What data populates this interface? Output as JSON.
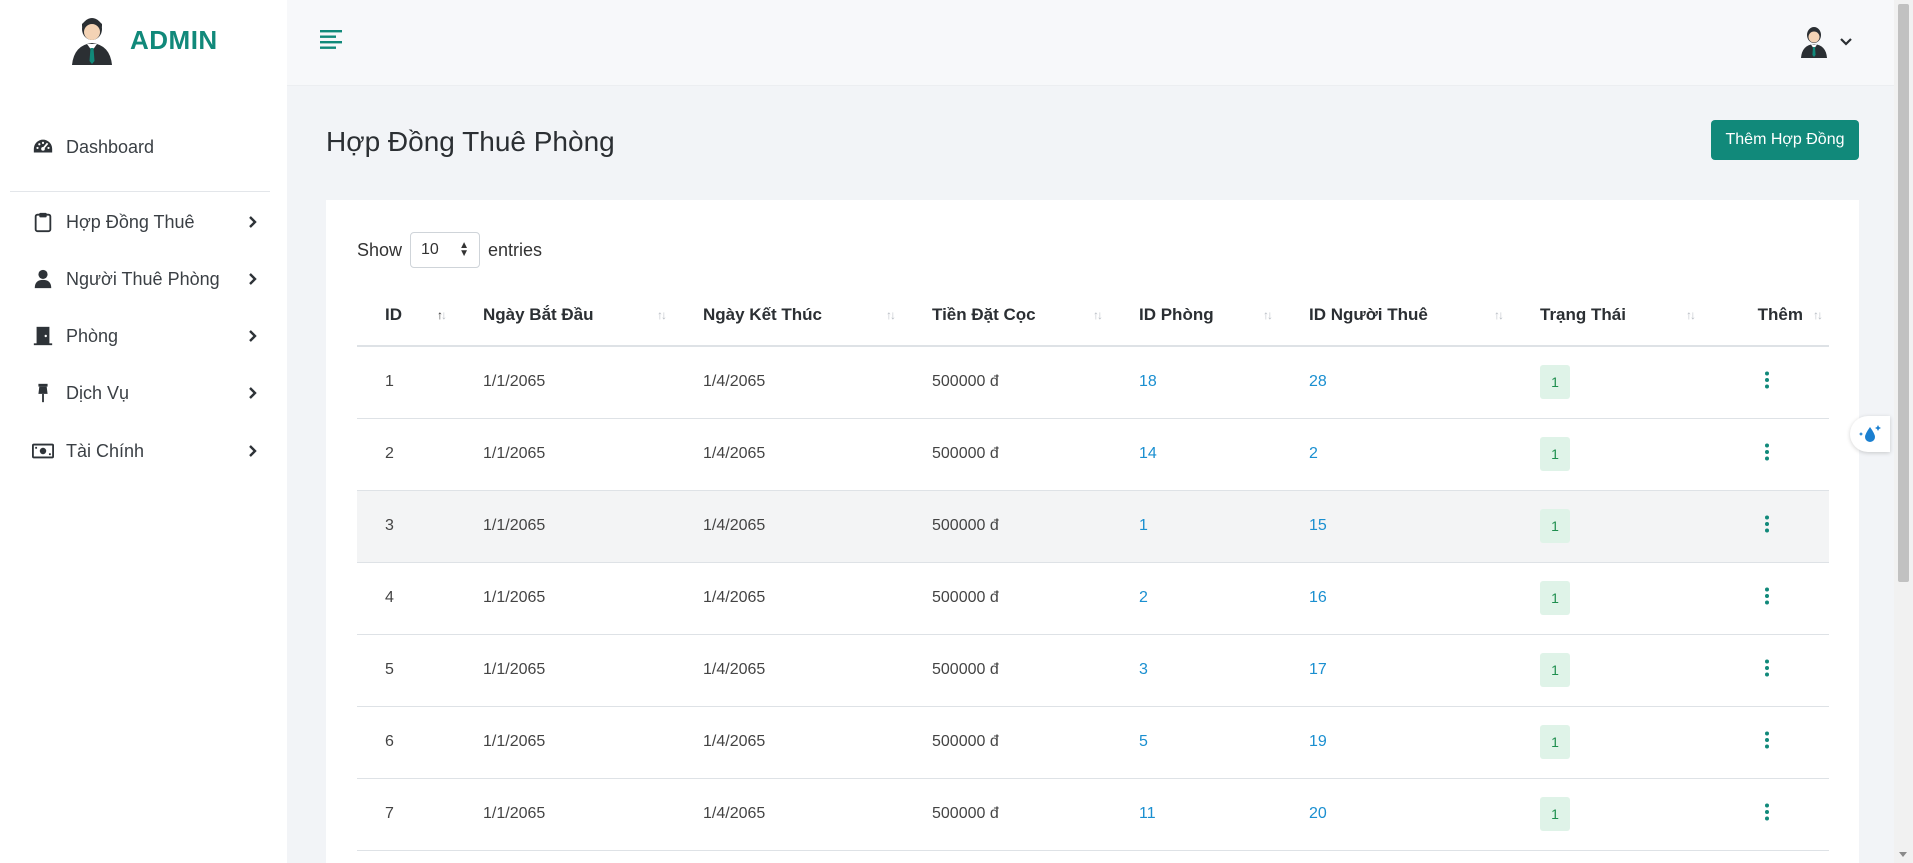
{
  "brand": {
    "title": "ADMIN"
  },
  "sidebar": {
    "dashboard": "Dashboard",
    "items": [
      {
        "label": "Hợp Đồng Thuê",
        "icon": "clipboard-icon"
      },
      {
        "label": "Người Thuê Phòng",
        "icon": "user-icon"
      },
      {
        "label": "Phòng",
        "icon": "door-icon"
      },
      {
        "label": "Dịch Vụ",
        "icon": "pin-icon"
      },
      {
        "label": "Tài Chính",
        "icon": "money-icon"
      }
    ]
  },
  "page": {
    "title": "Hợp Đồng Thuê Phòng",
    "add_button": "Thêm Hợp Đồng"
  },
  "table_controls": {
    "show": "Show",
    "entries_value": "10",
    "entries": "entries"
  },
  "table": {
    "columns": [
      "ID",
      "Ngày Bắt Đầu",
      "Ngày Kết Thúc",
      "Tiền Đặt Cọc",
      "ID Phòng",
      "ID Người Thuê",
      "Trạng Thái",
      "Thêm"
    ],
    "sorted_column": "ID",
    "rows": [
      {
        "id": "1",
        "start": "1/1/2065",
        "end": "1/4/2065",
        "deposit": "500000 đ",
        "room": "18",
        "tenant": "28",
        "status": "1"
      },
      {
        "id": "2",
        "start": "1/1/2065",
        "end": "1/4/2065",
        "deposit": "500000 đ",
        "room": "14",
        "tenant": "2",
        "status": "1"
      },
      {
        "id": "3",
        "start": "1/1/2065",
        "end": "1/4/2065",
        "deposit": "500000 đ",
        "room": "1",
        "tenant": "15",
        "status": "1"
      },
      {
        "id": "4",
        "start": "1/1/2065",
        "end": "1/4/2065",
        "deposit": "500000 đ",
        "room": "2",
        "tenant": "16",
        "status": "1"
      },
      {
        "id": "5",
        "start": "1/1/2065",
        "end": "1/4/2065",
        "deposit": "500000 đ",
        "room": "3",
        "tenant": "17",
        "status": "1"
      },
      {
        "id": "6",
        "start": "1/1/2065",
        "end": "1/4/2065",
        "deposit": "500000 đ",
        "room": "5",
        "tenant": "19",
        "status": "1"
      },
      {
        "id": "7",
        "start": "1/1/2065",
        "end": "1/4/2065",
        "deposit": "500000 đ",
        "room": "11",
        "tenant": "20",
        "status": "1"
      }
    ]
  },
  "colors": {
    "accent": "#11897a",
    "link": "#1a8fd0",
    "badge_bg": "#dff3e8",
    "badge_text": "#1e8e4e"
  }
}
